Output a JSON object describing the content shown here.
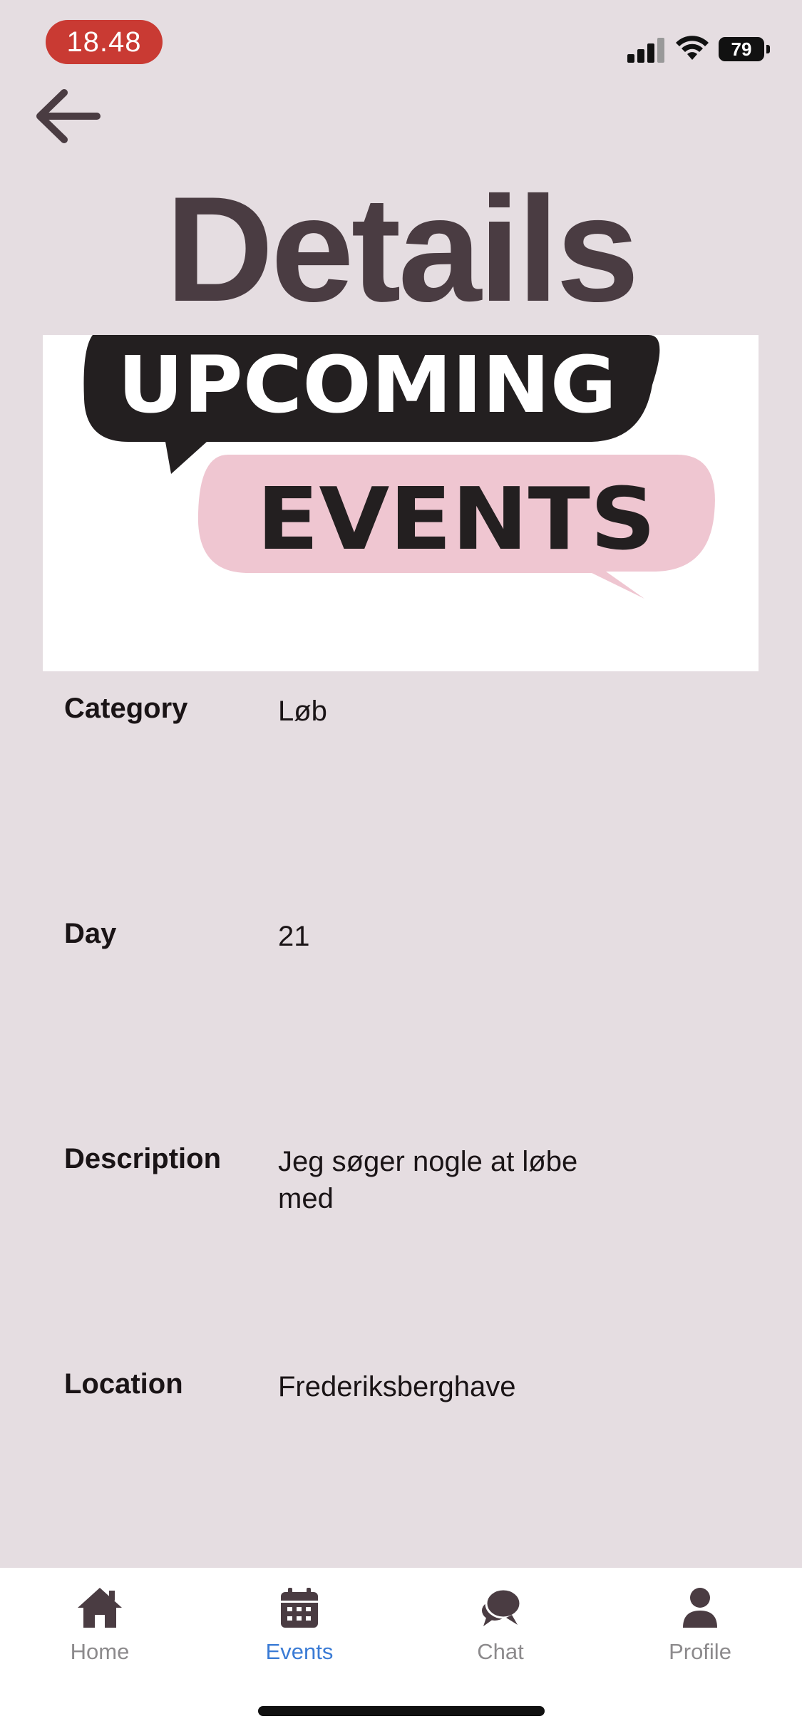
{
  "status_bar": {
    "time": "18.48",
    "battery": "79",
    "icons": [
      "signal-icon",
      "wifi-icon",
      "battery-icon"
    ]
  },
  "header": {
    "back_icon": "arrow-left-icon",
    "title": "Details"
  },
  "banner": {
    "line1": "UPCOMING",
    "line2": "EVENTS",
    "colors": {
      "dark_bubble": "#231f20",
      "pink_bubble": "#efc6d1"
    }
  },
  "details": [
    {
      "label": "Category",
      "value": "Løb"
    },
    {
      "label": "Day",
      "value": "21"
    },
    {
      "label": "Description",
      "value": "Jeg søger nogle at løbe med"
    },
    {
      "label": "Location",
      "value": "Frederiksberghave"
    }
  ],
  "tabbar": {
    "active": "Events",
    "tabs": [
      {
        "label": "Home",
        "icon": "home-icon"
      },
      {
        "label": "Events",
        "icon": "calendar-icon"
      },
      {
        "label": "Chat",
        "icon": "chat-bubbles-icon"
      },
      {
        "label": "Profile",
        "icon": "person-icon"
      }
    ]
  },
  "colors": {
    "background": "#e5dde1",
    "title": "#4a3c42",
    "time_pill": "#c93a33",
    "active_tab": "#3a7bd5",
    "inactive_tab": "#8c8a8c"
  }
}
